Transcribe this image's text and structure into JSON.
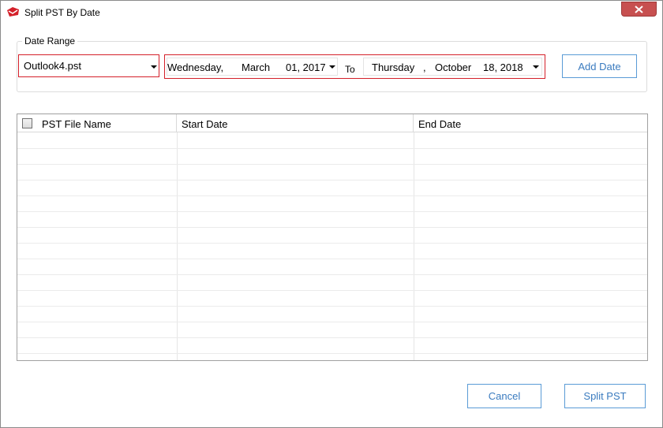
{
  "window": {
    "title": "Split PST By Date",
    "icon": "red-envelope-icon",
    "close_icon": "close-icon"
  },
  "date_range": {
    "label": "Date Range",
    "file_select": {
      "value": "Outlook4.pst"
    },
    "start": {
      "weekday": "Wednesday,",
      "month": "March",
      "day_year": "01, 2017"
    },
    "to_label": "To",
    "end": {
      "weekday": "Thursday",
      "sep": ",",
      "month": "October",
      "day_year": "18, 2018"
    },
    "add_button": "Add Date"
  },
  "table": {
    "columns": [
      "PST File Name",
      "Start Date",
      "End Date"
    ],
    "rows": []
  },
  "footer": {
    "cancel": "Cancel",
    "split": "Split PST"
  },
  "colors": {
    "accent": "#3a7bbf",
    "highlight_border": "#d4202a",
    "close_button": "#c75050"
  }
}
